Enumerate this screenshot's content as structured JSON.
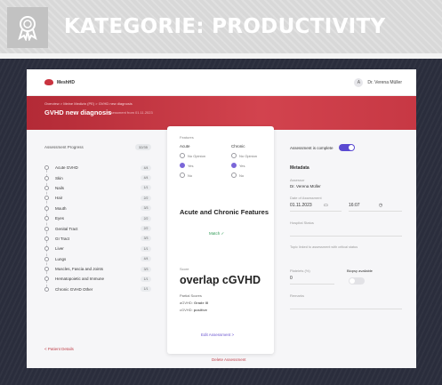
{
  "banner": {
    "title": "KATEGORIE: PRODUCTIVITY",
    "badge_icon": "award-ribbon-icon"
  },
  "app": {
    "logo": "MeshHD",
    "user_name": "Dr. Verena Müller",
    "breadcrumb": "Overview > Meine Medizin (PE) > GVHD new diagnosis",
    "page_title": "GVHD new diagnosis",
    "page_subtitle": "Assessment from 01.11.2023"
  },
  "progress": {
    "title": "Assessment Progress",
    "total": "32/35",
    "items": [
      {
        "label": "Acute GVHD",
        "count": "4/4"
      },
      {
        "label": "Skin",
        "count": "4/4"
      },
      {
        "label": "Nails",
        "count": "1/1"
      },
      {
        "label": "Hair",
        "count": "2/2"
      },
      {
        "label": "Mouth",
        "count": "3/3"
      },
      {
        "label": "Eyes",
        "count": "2/2"
      },
      {
        "label": "Genital Tract",
        "count": "2/2"
      },
      {
        "label": "GI Tract",
        "count": "3/3"
      },
      {
        "label": "Liver",
        "count": "1/1"
      },
      {
        "label": "Lungs",
        "count": "4/4"
      },
      {
        "label": "Muscles, Fascia and Joints",
        "count": "3/3"
      },
      {
        "label": "Hematopoietic and Immune",
        "count": "1/1"
      },
      {
        "label": "Chronic GVHD Other",
        "count": "1/1"
      }
    ],
    "patient_link": "< Patient Details"
  },
  "card": {
    "features_label": "Features",
    "acute_label": "Acute",
    "chronic_label": "Chronic",
    "options": [
      "No Opinion",
      "Yes",
      "No"
    ],
    "section_title": "Acute and Chronic Features",
    "match": "Match ✓",
    "score_label": "Score",
    "big_title": "overlap cGVHD",
    "partial_label": "Partial Scores",
    "agvhd": "aGVHD:",
    "agvhd_value": "Grade III",
    "cgvhd": "cGVHD:",
    "cgvhd_value": "positive",
    "edit_link": "Edit Assessment >",
    "delete_link": "Delete Assessment"
  },
  "right": {
    "complete_label": "Assessment is complete",
    "metadata_title": "Metadata",
    "assessor_label": "Assessor",
    "assessor_value": "Dr. Verena Müller",
    "date_label": "Date of Assessment",
    "date_value": "01.11.2023",
    "time_value": "16:07",
    "status_label": "Hospital Status",
    "info_text": "Topic linked to assessment with critical status",
    "platelets_label": "Platelets (%)",
    "platelets_value": "0",
    "biopsy_label": "Biopsy available",
    "remarks_label": "Remarks"
  },
  "colors": {
    "accent_red": "#c9333f",
    "accent_purple": "#5b4ad1",
    "frame": "#2a2d3c"
  }
}
